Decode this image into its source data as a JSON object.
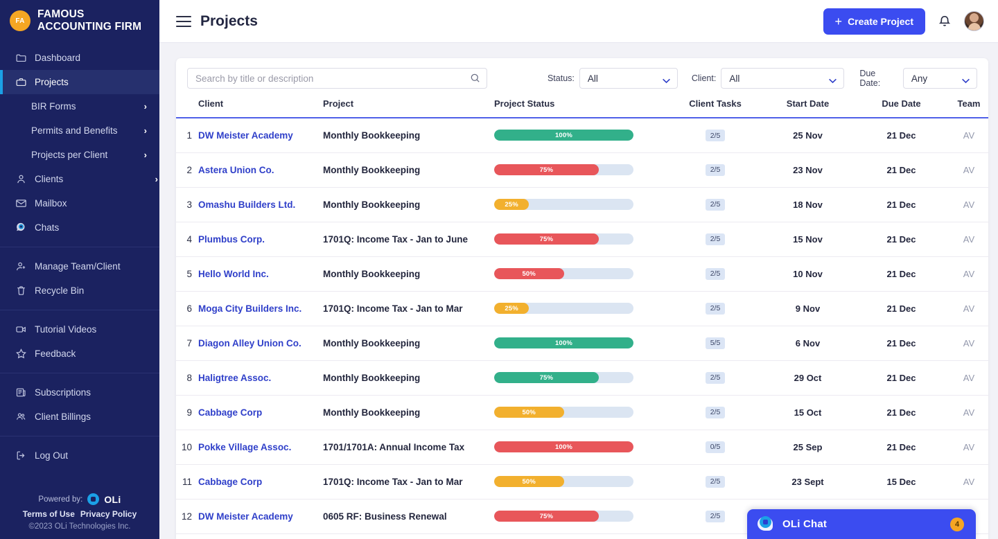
{
  "sidebar": {
    "brand": {
      "initials": "FA",
      "line1": "FAMOUS",
      "line2": "ACCOUNTING FIRM"
    },
    "items": [
      {
        "label": "Dashboard",
        "icon": "folder-icon",
        "sub": false,
        "active": false,
        "chevron": false
      },
      {
        "label": "Projects",
        "icon": "briefcase-icon",
        "sub": false,
        "active": true,
        "chevron": false
      },
      {
        "label": "BIR Forms",
        "icon": "",
        "sub": true,
        "active": false,
        "chevron": true
      },
      {
        "label": "Permits and Benefits",
        "icon": "",
        "sub": true,
        "active": false,
        "chevron": true
      },
      {
        "label": "Projects per Client",
        "icon": "",
        "sub": true,
        "active": false,
        "chevron": true
      },
      {
        "label": "Clients",
        "icon": "user-icon",
        "sub": false,
        "active": false,
        "chevron": true
      },
      {
        "label": "Mailbox",
        "icon": "envelope-icon",
        "sub": false,
        "active": false,
        "chevron": false
      },
      {
        "label": "Chats",
        "icon": "chat-icon",
        "sub": false,
        "active": false,
        "chevron": false
      },
      {
        "label": "Manage Team/Client",
        "icon": "user-plus-icon",
        "sub": false,
        "active": false,
        "chevron": false
      },
      {
        "label": "Recycle Bin",
        "icon": "trash-icon",
        "sub": false,
        "active": false,
        "chevron": false
      },
      {
        "label": "Tutorial Videos",
        "icon": "video-icon",
        "sub": false,
        "active": false,
        "chevron": false
      },
      {
        "label": "Feedback",
        "icon": "star-icon",
        "sub": false,
        "active": false,
        "chevron": false
      },
      {
        "label": "Subscriptions",
        "icon": "news-icon",
        "sub": false,
        "active": false,
        "chevron": false
      },
      {
        "label": "Client Billings",
        "icon": "people-icon",
        "sub": false,
        "active": false,
        "chevron": false
      },
      {
        "label": "Log Out",
        "icon": "logout-icon",
        "sub": false,
        "active": false,
        "chevron": false
      }
    ],
    "footer": {
      "powered_by": "Powered by:",
      "oli_word": "OLi",
      "terms": "Terms of Use",
      "privacy": "Privacy Policy",
      "copyright": "©2023 OLi Technologies Inc."
    }
  },
  "topbar": {
    "menu_icon": "hamburger-icon",
    "title": "Projects",
    "create_label": "Create Project",
    "bell_icon": "bell-icon",
    "avatar": "user-avatar"
  },
  "filters": {
    "search_placeholder": "Search by title or description",
    "search_value": "",
    "status": {
      "label": "Status:",
      "value": "All"
    },
    "client": {
      "label": "Client:",
      "value": "All"
    },
    "due_date": {
      "label": "Due Date:",
      "value": "Any"
    }
  },
  "table": {
    "headers": [
      "Client",
      "Project",
      "Project Status",
      "Client Tasks",
      "Start Date",
      "Due Date",
      "Team"
    ],
    "rows": [
      {
        "num": "1",
        "client": "DW Meister Academy",
        "project": "Monthly Bookkeeping",
        "percent": "100%",
        "pct": 100,
        "color": "#32b08a",
        "tasks": "2/5",
        "start": "25 Nov",
        "due": "21 Dec",
        "team": "AV"
      },
      {
        "num": "2",
        "client": "Astera Union Co.",
        "project": "Monthly Bookkeeping",
        "percent": "75%",
        "pct": 75,
        "color": "#e8565a",
        "tasks": "2/5",
        "start": "23 Nov",
        "due": "21 Dec",
        "team": "AV"
      },
      {
        "num": "3",
        "client": "Omashu Builders Ltd.",
        "project": "Monthly Bookkeeping",
        "percent": "25%",
        "pct": 25,
        "color": "#f2b02e",
        "tasks": "2/5",
        "start": "18 Nov",
        "due": "21 Dec",
        "team": "AV"
      },
      {
        "num": "4",
        "client": "Plumbus Corp.",
        "project": "1701Q: Income Tax - Jan to June",
        "percent": "75%",
        "pct": 75,
        "color": "#e8565a",
        "tasks": "2/5",
        "start": "15 Nov",
        "due": "21 Dec",
        "team": "AV"
      },
      {
        "num": "5",
        "client": "Hello World Inc.",
        "project": "Monthly Bookkeeping",
        "percent": "50%",
        "pct": 50,
        "color": "#e8565a",
        "tasks": "2/5",
        "start": "10 Nov",
        "due": "21 Dec",
        "team": "AV"
      },
      {
        "num": "6",
        "client": "Moga City Builders Inc.",
        "project": "1701Q: Income Tax - Jan to Mar",
        "percent": "25%",
        "pct": 25,
        "color": "#f2b02e",
        "tasks": "2/5",
        "start": "9 Nov",
        "due": "21 Dec",
        "team": "AV"
      },
      {
        "num": "7",
        "client": "Diagon Alley Union Co.",
        "project": "Monthly Bookkeeping",
        "percent": "100%",
        "pct": 100,
        "color": "#32b08a",
        "tasks": "5/5",
        "start": "6 Nov",
        "due": "21 Dec",
        "team": "AV"
      },
      {
        "num": "8",
        "client": "Haligtree Assoc.",
        "project": "Monthly Bookkeeping",
        "percent": "75%",
        "pct": 75,
        "color": "#32b08a",
        "tasks": "2/5",
        "start": "29 Oct",
        "due": "21 Dec",
        "team": "AV"
      },
      {
        "num": "9",
        "client": "Cabbage Corp",
        "project": "Monthly Bookkeeping",
        "percent": "50%",
        "pct": 50,
        "color": "#f2b02e",
        "tasks": "2/5",
        "start": "15 Oct",
        "due": "21 Dec",
        "team": "AV"
      },
      {
        "num": "10",
        "client": "Pokke Village Assoc.",
        "project": "1701/1701A: Annual Income Tax",
        "percent": "100%",
        "pct": 100,
        "color": "#e8565a",
        "tasks": "0/5",
        "start": "25 Sep",
        "due": "21 Dec",
        "team": "AV"
      },
      {
        "num": "11",
        "client": "Cabbage Corp",
        "project": "1701Q: Income Tax - Jan to Mar",
        "percent": "50%",
        "pct": 50,
        "color": "#f2b02e",
        "tasks": "2/5",
        "start": "23 Sept",
        "due": "15 Dec",
        "team": "AV"
      },
      {
        "num": "12",
        "client": "DW Meister Academy",
        "project": "0605 RF: Business Renewal",
        "percent": "75%",
        "pct": 75,
        "color": "#e8565a",
        "tasks": "2/5",
        "start": "",
        "due": "",
        "team": ""
      }
    ]
  },
  "chat": {
    "title": "OLi Chat",
    "badge": "4",
    "icon": "oli-chat-icon"
  },
  "colors": {
    "accent": "#3b4cf0",
    "sidebar": "#1b2260",
    "green": "#32b08a",
    "red": "#e8565a",
    "yellow": "#f2b02e",
    "track": "#dbe5f2",
    "brand_orange": "#f5a623"
  }
}
